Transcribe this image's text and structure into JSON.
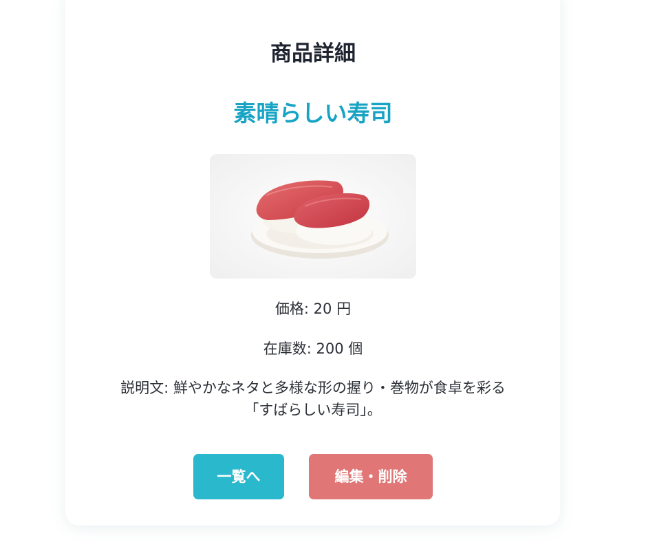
{
  "header": {
    "title": "商品詳細"
  },
  "product": {
    "name": "素晴らしい寿司",
    "image_alt": "マグロの握り寿司",
    "price_text": "価格: 20 円",
    "stock_text": "在庫数: 200 個",
    "description_line1": "説明文: 鮮やかなネタと多様な形の握り・巻物が食卓を彩る",
    "description_line2": "「すばらしい寿司」。"
  },
  "actions": {
    "list_label": "一覧へ",
    "edit_delete_label": "編集・削除"
  },
  "colors": {
    "accent": "#17a3c4",
    "list_button": "#2ab8cc",
    "edit_button": "#e07676",
    "text": "#2b2f36"
  }
}
